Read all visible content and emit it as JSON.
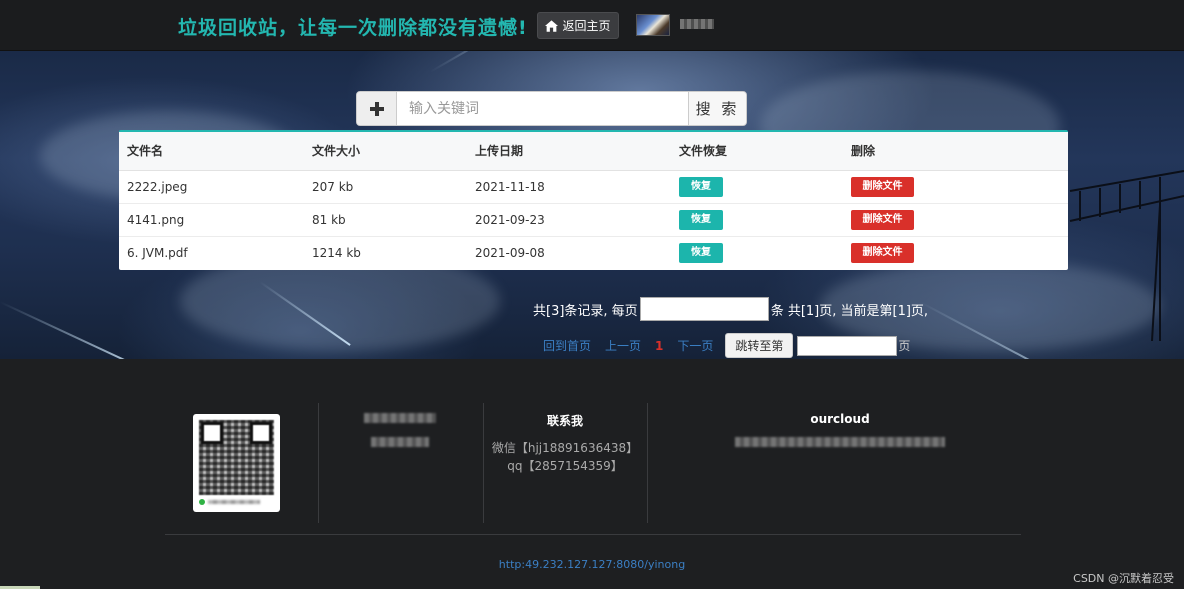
{
  "navbar": {
    "brand": "垃圾回收站，让每一次删除都没有遗憾!",
    "home_label": "返回主页"
  },
  "search": {
    "placeholder": "输入关键词",
    "button_label": "搜 索"
  },
  "table": {
    "columns": [
      "文件名",
      "文件大小",
      "上传日期",
      "文件恢复",
      "删除"
    ],
    "rows": [
      {
        "name": "2222.jpeg",
        "size": "207 kb",
        "date": "2021-11-18",
        "restore": "恢复",
        "delete": "删除文件"
      },
      {
        "name": "4141.png",
        "size": "81 kb",
        "date": "2021-09-23",
        "restore": "恢复",
        "delete": "删除文件"
      },
      {
        "name": "6. JVM.pdf",
        "size": "1214 kb",
        "date": "2021-09-08",
        "restore": "恢复",
        "delete": "删除文件"
      }
    ]
  },
  "pagination": {
    "info_prefix": "共[3]条记录, 每页",
    "info_suffix": "条 共[1]页, 当前是第[1]页,",
    "first": "回到首页",
    "prev": "上一页",
    "current": "1",
    "next": "下一页",
    "jump_label": "跳转至第",
    "jump_suffix": "页"
  },
  "footer": {
    "contact_title": "联系我",
    "wechat": "微信【hjj18891636438】",
    "qq": "qq【2857154359】",
    "cloud_title": "ourcloud",
    "url": "http:49.232.127.127:8080/yinong"
  },
  "watermark": "CSDN @沉默着忍受"
}
